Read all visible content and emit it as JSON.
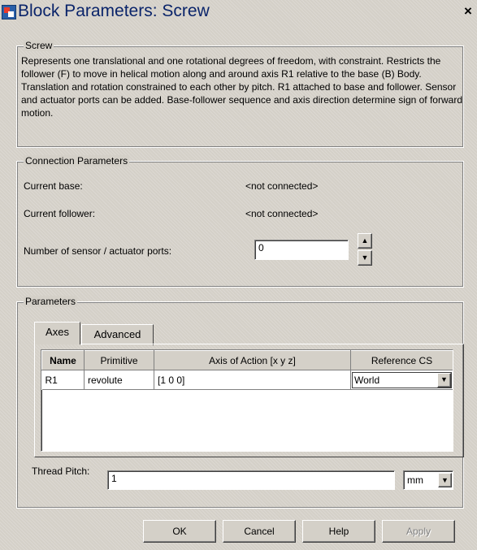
{
  "window": {
    "title": "Block Parameters: Screw",
    "close_glyph": "×"
  },
  "screw_group": {
    "legend": "Screw",
    "description": "Represents one translational and one rotational degrees of freedom, with constraint. Restricts the follower (F) to move in helical motion along and around axis R1 relative to the base (B) Body. Translation and rotation constrained to each other by pitch. R1 attached to base and follower. Sensor and actuator ports can be added. Base-follower sequence and axis direction determine sign of forward motion."
  },
  "connection": {
    "legend": "Connection Parameters",
    "current_base_label": "Current base:",
    "current_base_value": "<not connected>",
    "current_follower_label": "Current follower:",
    "current_follower_value": "<not connected>",
    "ports_label": "Number of sensor / actuator ports:",
    "ports_value": "0",
    "up_glyph": "▲",
    "down_glyph": "▼"
  },
  "parameters": {
    "legend": "Parameters",
    "tabs": [
      {
        "label": "Axes",
        "active": true
      },
      {
        "label": "Advanced",
        "active": false
      }
    ],
    "table": {
      "headers": [
        "Name",
        "Primitive",
        "Axis of Action [x y z]",
        "Reference CS"
      ],
      "rows": [
        {
          "name": "R1",
          "primitive": "revolute",
          "axis": "[1 0 0]",
          "reference_cs": "World"
        }
      ]
    },
    "dropdown_glyph": "▼",
    "thread_pitch_label": "Thread Pitch:",
    "thread_pitch_value": "1",
    "thread_pitch_unit": "mm"
  },
  "buttons": {
    "ok": "OK",
    "cancel": "Cancel",
    "help": "Help",
    "apply": "Apply"
  },
  "colors": {
    "dialog_bg": "#d4d0c8",
    "title_text": "#0a246a",
    "disabled_text": "#808080"
  },
  "icons": {
    "window_icon": "simulink-block-icon",
    "close": "close-icon",
    "spin_up": "up-arrow-icon",
    "spin_down": "down-arrow-icon",
    "dropdown": "chevron-down-icon"
  }
}
